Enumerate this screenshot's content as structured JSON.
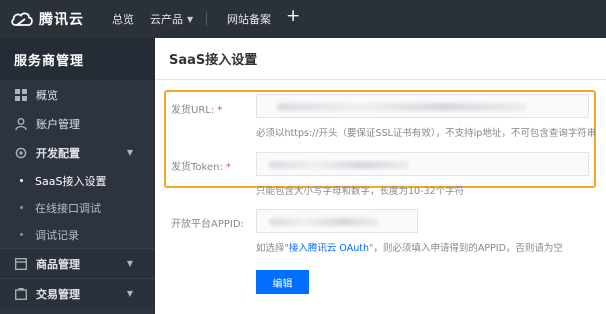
{
  "topbar": {
    "logo_text": "腾讯云",
    "nav": {
      "home": "总览",
      "products": "云产品",
      "icp": "网站备案",
      "plus": "+"
    }
  },
  "sidebar": {
    "title": "服务商管理",
    "items": [
      {
        "label": "概览",
        "icon": "grid-icon"
      },
      {
        "label": "账户管理",
        "icon": "user-icon"
      },
      {
        "label": "开发配置",
        "icon": "gear-icon",
        "expanded": true
      },
      {
        "label": "SaaS接入设置",
        "active": true
      },
      {
        "label": "在线接口调试"
      },
      {
        "label": "调试记录"
      },
      {
        "label": "商品管理",
        "icon": "box-icon"
      },
      {
        "label": "交易管理",
        "icon": "cart-icon"
      }
    ]
  },
  "main": {
    "title": "SaaS接入设置",
    "fields": {
      "url": {
        "label": "发货URL:",
        "required": "*",
        "hint": "必须以https://开头（要保证SSL证书有效），不支持ip地址，不可包含查询字符串"
      },
      "token": {
        "label": "发货Token:",
        "required": "*",
        "hint": "只能包含大小写字母和数字，长度为10-32个字符"
      },
      "appid": {
        "label": "开放平台APPID:",
        "hint_prefix": "如选择\"",
        "hint_link": "接入腾讯云 OAuth",
        "hint_suffix": "\"，则必须填入申请得到的APPID，否则请为空"
      }
    },
    "edit_button": "编辑"
  },
  "colors": {
    "topbar": "#2b3139",
    "sidebar": "#2d3440",
    "accent": "#006eff",
    "highlight": "#f5a623",
    "required": "#e1504a"
  }
}
